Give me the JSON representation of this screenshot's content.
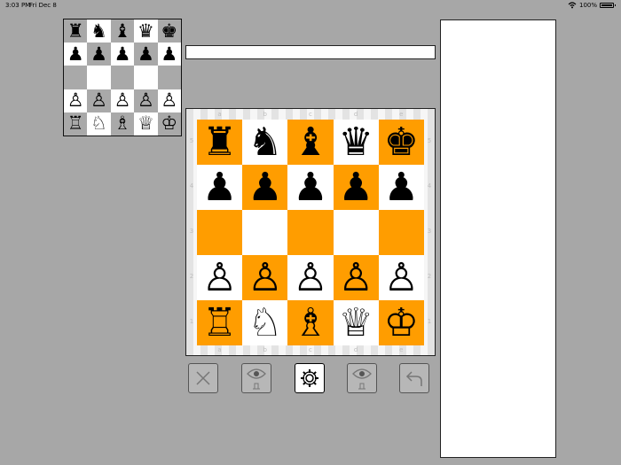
{
  "status_bar": {
    "time": "3:03 PM",
    "date": "Fri Dec 8",
    "battery": "100%",
    "wifi_icon": "wifi-icon",
    "battery_icon": "battery-icon"
  },
  "mini_board": {
    "ranks": [
      [
        "♜",
        "♞",
        "♝",
        "♛",
        "♚"
      ],
      [
        "♟",
        "♟",
        "♟",
        "♟",
        "♟"
      ],
      [
        "",
        "",
        "",
        "",
        ""
      ],
      [
        "♙",
        "♙",
        "♙",
        "♙",
        "♙"
      ],
      [
        "♖",
        "♘",
        "♗",
        "♕",
        "♔"
      ]
    ]
  },
  "message": {
    "text": ""
  },
  "main_board": {
    "files": [
      "a",
      "b",
      "c",
      "d",
      "e"
    ],
    "ranks": [
      "5",
      "4",
      "3",
      "2",
      "1"
    ],
    "squares": [
      [
        "♜",
        "♞",
        "♝",
        "♛",
        "♚"
      ],
      [
        "♟",
        "♟",
        "♟",
        "♟",
        "♟"
      ],
      [
        "",
        "",
        "",
        "",
        ""
      ],
      [
        "♙",
        "♙",
        "♙",
        "♙",
        "♙"
      ],
      [
        "♖",
        "♘",
        "♗",
        "♕",
        "♔"
      ]
    ],
    "light_color": "#ffffff",
    "dark_color": "#ff9d00"
  },
  "controls": {
    "buttons": [
      {
        "name": "close-button",
        "icon": "close-icon",
        "active": false
      },
      {
        "name": "show-hide-button-1",
        "icon": "eye-icon",
        "active": false
      },
      {
        "name": "settings-button",
        "icon": "gear-icon",
        "active": true
      },
      {
        "name": "show-hide-button-2",
        "icon": "eye-icon",
        "active": false
      },
      {
        "name": "undo-button",
        "icon": "undo-icon",
        "active": false
      }
    ]
  },
  "side_panel": {
    "text": ""
  },
  "colors": {
    "background": "#a7a7a7",
    "panel": "#ffffff",
    "orange": "#ff9d00"
  }
}
